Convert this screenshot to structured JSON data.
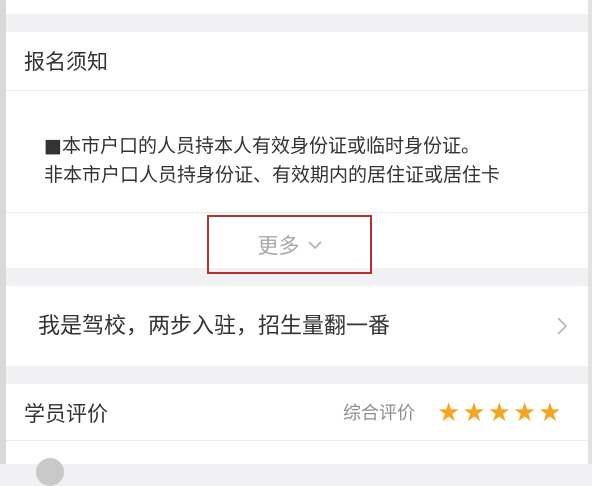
{
  "notice": {
    "title": "报名须知",
    "lines": [
      "■本市户口的人员持本人有效身份证或临时身份证。",
      "非本市户口人员持身份证、有效期内的居住证或居住卡"
    ],
    "more_label": "更多"
  },
  "promo": {
    "text": "我是驾校，两步入驻，招生量翻一番"
  },
  "reviews": {
    "title": "学员评价",
    "overall_label": "综合评价",
    "rating": 5,
    "star_glyph": "★"
  },
  "colors": {
    "star": "#f4a623",
    "highlight_border": "#b8302c",
    "muted_text": "#a8a8a8"
  }
}
